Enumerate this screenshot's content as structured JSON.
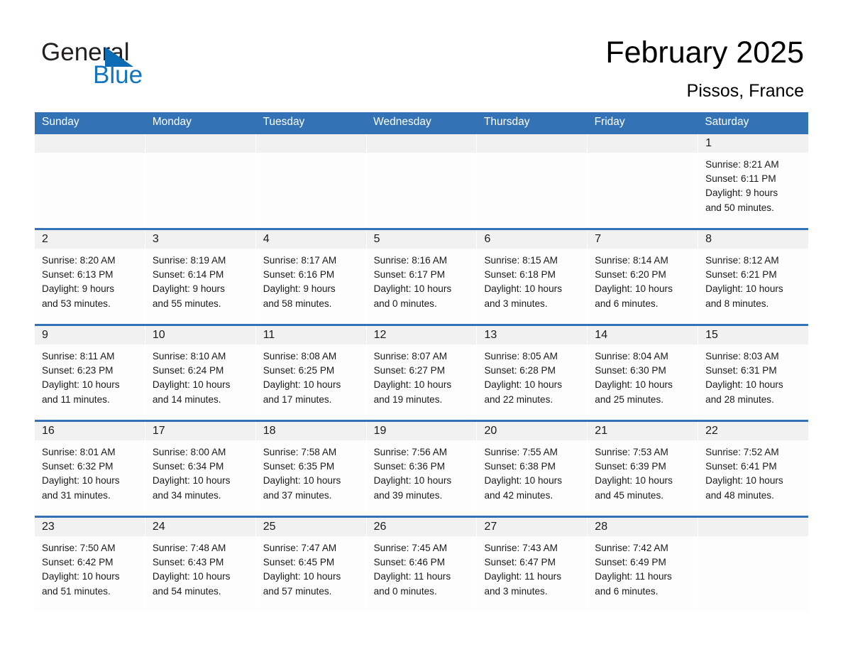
{
  "logo": {
    "word_one": "General",
    "word_two": "Blue",
    "triangle_color": "#0b6bb4",
    "blue_color": "#1175c0"
  },
  "header": {
    "title": "February 2025",
    "subtitle": "Pissos, France"
  },
  "theme": {
    "header_blue": "#3272b5",
    "day_band_gray": "#f1f1f1",
    "cell_white": "#fdfdfd",
    "text_color": "#1a1a1a"
  },
  "weekdays": [
    "Sunday",
    "Monday",
    "Tuesday",
    "Wednesday",
    "Thursday",
    "Friday",
    "Saturday"
  ],
  "weeks": [
    [
      {
        "day": "",
        "sunrise": "",
        "sunset": "",
        "daylight_line1": "",
        "daylight_line2": ""
      },
      {
        "day": "",
        "sunrise": "",
        "sunset": "",
        "daylight_line1": "",
        "daylight_line2": ""
      },
      {
        "day": "",
        "sunrise": "",
        "sunset": "",
        "daylight_line1": "",
        "daylight_line2": ""
      },
      {
        "day": "",
        "sunrise": "",
        "sunset": "",
        "daylight_line1": "",
        "daylight_line2": ""
      },
      {
        "day": "",
        "sunrise": "",
        "sunset": "",
        "daylight_line1": "",
        "daylight_line2": ""
      },
      {
        "day": "",
        "sunrise": "",
        "sunset": "",
        "daylight_line1": "",
        "daylight_line2": ""
      },
      {
        "day": "1",
        "sunrise": "Sunrise: 8:21 AM",
        "sunset": "Sunset: 6:11 PM",
        "daylight_line1": "Daylight: 9 hours",
        "daylight_line2": "and 50 minutes."
      }
    ],
    [
      {
        "day": "2",
        "sunrise": "Sunrise: 8:20 AM",
        "sunset": "Sunset: 6:13 PM",
        "daylight_line1": "Daylight: 9 hours",
        "daylight_line2": "and 53 minutes."
      },
      {
        "day": "3",
        "sunrise": "Sunrise: 8:19 AM",
        "sunset": "Sunset: 6:14 PM",
        "daylight_line1": "Daylight: 9 hours",
        "daylight_line2": "and 55 minutes."
      },
      {
        "day": "4",
        "sunrise": "Sunrise: 8:17 AM",
        "sunset": "Sunset: 6:16 PM",
        "daylight_line1": "Daylight: 9 hours",
        "daylight_line2": "and 58 minutes."
      },
      {
        "day": "5",
        "sunrise": "Sunrise: 8:16 AM",
        "sunset": "Sunset: 6:17 PM",
        "daylight_line1": "Daylight: 10 hours",
        "daylight_line2": "and 0 minutes."
      },
      {
        "day": "6",
        "sunrise": "Sunrise: 8:15 AM",
        "sunset": "Sunset: 6:18 PM",
        "daylight_line1": "Daylight: 10 hours",
        "daylight_line2": "and 3 minutes."
      },
      {
        "day": "7",
        "sunrise": "Sunrise: 8:14 AM",
        "sunset": "Sunset: 6:20 PM",
        "daylight_line1": "Daylight: 10 hours",
        "daylight_line2": "and 6 minutes."
      },
      {
        "day": "8",
        "sunrise": "Sunrise: 8:12 AM",
        "sunset": "Sunset: 6:21 PM",
        "daylight_line1": "Daylight: 10 hours",
        "daylight_line2": "and 8 minutes."
      }
    ],
    [
      {
        "day": "9",
        "sunrise": "Sunrise: 8:11 AM",
        "sunset": "Sunset: 6:23 PM",
        "daylight_line1": "Daylight: 10 hours",
        "daylight_line2": "and 11 minutes."
      },
      {
        "day": "10",
        "sunrise": "Sunrise: 8:10 AM",
        "sunset": "Sunset: 6:24 PM",
        "daylight_line1": "Daylight: 10 hours",
        "daylight_line2": "and 14 minutes."
      },
      {
        "day": "11",
        "sunrise": "Sunrise: 8:08 AM",
        "sunset": "Sunset: 6:25 PM",
        "daylight_line1": "Daylight: 10 hours",
        "daylight_line2": "and 17 minutes."
      },
      {
        "day": "12",
        "sunrise": "Sunrise: 8:07 AM",
        "sunset": "Sunset: 6:27 PM",
        "daylight_line1": "Daylight: 10 hours",
        "daylight_line2": "and 19 minutes."
      },
      {
        "day": "13",
        "sunrise": "Sunrise: 8:05 AM",
        "sunset": "Sunset: 6:28 PM",
        "daylight_line1": "Daylight: 10 hours",
        "daylight_line2": "and 22 minutes."
      },
      {
        "day": "14",
        "sunrise": "Sunrise: 8:04 AM",
        "sunset": "Sunset: 6:30 PM",
        "daylight_line1": "Daylight: 10 hours",
        "daylight_line2": "and 25 minutes."
      },
      {
        "day": "15",
        "sunrise": "Sunrise: 8:03 AM",
        "sunset": "Sunset: 6:31 PM",
        "daylight_line1": "Daylight: 10 hours",
        "daylight_line2": "and 28 minutes."
      }
    ],
    [
      {
        "day": "16",
        "sunrise": "Sunrise: 8:01 AM",
        "sunset": "Sunset: 6:32 PM",
        "daylight_line1": "Daylight: 10 hours",
        "daylight_line2": "and 31 minutes."
      },
      {
        "day": "17",
        "sunrise": "Sunrise: 8:00 AM",
        "sunset": "Sunset: 6:34 PM",
        "daylight_line1": "Daylight: 10 hours",
        "daylight_line2": "and 34 minutes."
      },
      {
        "day": "18",
        "sunrise": "Sunrise: 7:58 AM",
        "sunset": "Sunset: 6:35 PM",
        "daylight_line1": "Daylight: 10 hours",
        "daylight_line2": "and 37 minutes."
      },
      {
        "day": "19",
        "sunrise": "Sunrise: 7:56 AM",
        "sunset": "Sunset: 6:36 PM",
        "daylight_line1": "Daylight: 10 hours",
        "daylight_line2": "and 39 minutes."
      },
      {
        "day": "20",
        "sunrise": "Sunrise: 7:55 AM",
        "sunset": "Sunset: 6:38 PM",
        "daylight_line1": "Daylight: 10 hours",
        "daylight_line2": "and 42 minutes."
      },
      {
        "day": "21",
        "sunrise": "Sunrise: 7:53 AM",
        "sunset": "Sunset: 6:39 PM",
        "daylight_line1": "Daylight: 10 hours",
        "daylight_line2": "and 45 minutes."
      },
      {
        "day": "22",
        "sunrise": "Sunrise: 7:52 AM",
        "sunset": "Sunset: 6:41 PM",
        "daylight_line1": "Daylight: 10 hours",
        "daylight_line2": "and 48 minutes."
      }
    ],
    [
      {
        "day": "23",
        "sunrise": "Sunrise: 7:50 AM",
        "sunset": "Sunset: 6:42 PM",
        "daylight_line1": "Daylight: 10 hours",
        "daylight_line2": "and 51 minutes."
      },
      {
        "day": "24",
        "sunrise": "Sunrise: 7:48 AM",
        "sunset": "Sunset: 6:43 PM",
        "daylight_line1": "Daylight: 10 hours",
        "daylight_line2": "and 54 minutes."
      },
      {
        "day": "25",
        "sunrise": "Sunrise: 7:47 AM",
        "sunset": "Sunset: 6:45 PM",
        "daylight_line1": "Daylight: 10 hours",
        "daylight_line2": "and 57 minutes."
      },
      {
        "day": "26",
        "sunrise": "Sunrise: 7:45 AM",
        "sunset": "Sunset: 6:46 PM",
        "daylight_line1": "Daylight: 11 hours",
        "daylight_line2": "and 0 minutes."
      },
      {
        "day": "27",
        "sunrise": "Sunrise: 7:43 AM",
        "sunset": "Sunset: 6:47 PM",
        "daylight_line1": "Daylight: 11 hours",
        "daylight_line2": "and 3 minutes."
      },
      {
        "day": "28",
        "sunrise": "Sunrise: 7:42 AM",
        "sunset": "Sunset: 6:49 PM",
        "daylight_line1": "Daylight: 11 hours",
        "daylight_line2": "and 6 minutes."
      },
      {
        "day": "",
        "sunrise": "",
        "sunset": "",
        "daylight_line1": "",
        "daylight_line2": ""
      }
    ]
  ]
}
